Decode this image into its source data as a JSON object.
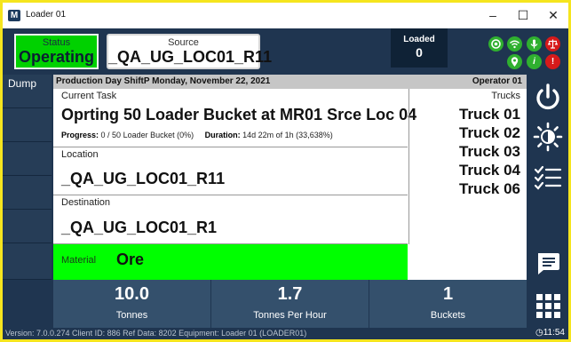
{
  "window": {
    "title": "Loader 01",
    "app_icon": "M"
  },
  "header": {
    "status_label": "Status",
    "status_value": "Operating",
    "source_label": "Source",
    "source_value": "_QA_UG_LOC01_R11",
    "loaded_label": "Loaded",
    "loaded_value": "0",
    "status_icons": [
      "gps-icon",
      "wifi-icon",
      "microphone-icon",
      "scale-icon",
      "location-icon",
      "info-icon",
      "alert-icon"
    ],
    "alert_glyph": "!",
    "info_glyph": "i"
  },
  "left": {
    "dump_label": "Dump"
  },
  "info_bar": {
    "left": "Production Day ShiftP Monday, November 22, 2021",
    "right": "Operator 01"
  },
  "task": {
    "label": "Current Task",
    "value": "Oprting 50 Loader Bucket at MR01 Srce Loc 04",
    "progress_label": "Progress:",
    "progress_value": "0 / 50 Loader Bucket (0%)",
    "duration_label": "Duration:",
    "duration_value": "14d  22m of 1h (33,638%)"
  },
  "location": {
    "label": "Location",
    "value": "_QA_UG_LOC01_R11"
  },
  "destination": {
    "label": "Destination",
    "value": "_QA_UG_LOC01_R1"
  },
  "material": {
    "label": "Material",
    "value": "Ore"
  },
  "trucks": {
    "label": "Trucks",
    "items": [
      "Truck 01",
      "Truck 02",
      "Truck 03",
      "Truck 04",
      "Truck 06"
    ]
  },
  "stats": [
    {
      "value": "10.0",
      "label": "Tonnes"
    },
    {
      "value": "1.7",
      "label": "Tonnes Per Hour"
    },
    {
      "value": "1",
      "label": "Buckets"
    }
  ],
  "footer": {
    "text": "Version: 7.0.0.274  Client ID: 886  Ref Data: 8202  Equipment: Loader 01 (LOADER01)",
    "time": "11:54"
  },
  "colors": {
    "status_green": "#00d100",
    "material_green": "#00ff00",
    "panel_navy": "#1f3550",
    "background_yellow": "#f5e51e"
  }
}
